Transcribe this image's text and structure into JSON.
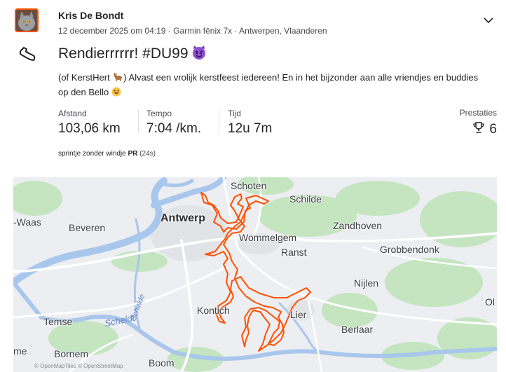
{
  "athlete": {
    "name": "Kris De Bondt"
  },
  "activity": {
    "meta": "12 december 2025 om 04:19 · Garmin fēnix 7x · Antwerpen, Vlaanderen",
    "title": "Rendierrrrrr! #DU99",
    "description_part1": "(of KerstHert ",
    "description_part2": ") Alvast een vrolijk kerstfeest iedereen! En in het bijzonder aan alle vriendjes en buddies op den Bello "
  },
  "stats": [
    {
      "label": "Afstand",
      "value": "103,06 km"
    },
    {
      "label": "Tempo",
      "value": "7:04 /km."
    },
    {
      "label": "Tijd",
      "value": "12u 7m"
    }
  ],
  "achievements": {
    "label": "Prestaties",
    "count": "6"
  },
  "segment_pr": {
    "name": "sprintje zonder windje",
    "badge": "PR",
    "time": "(24s)"
  },
  "map": {
    "places": {
      "schoten": "Schoten",
      "schilde": "Schilde",
      "waas": "-Waas",
      "beveren": "Beveren",
      "antwerp": "Antwerp",
      "zandhoven": "Zandhoven",
      "wommelgem": "Wommelgem",
      "ranst": "Ranst",
      "grobbendonk": "Grobbendonk",
      "nijlen": "Nijlen",
      "kontich": "Kontich",
      "lier": "Lier",
      "ol": "Ol",
      "temse": "Temse",
      "berlaar": "Berlaar",
      "bornem": "Bornem",
      "boom": "Boom",
      "me": "me"
    },
    "rivers": {
      "scheldt": "Scheldt",
      "schelde": "Schelde"
    },
    "copyright": "© OpenMapTiles © OpenStreetMap",
    "route_color": "#fc5200",
    "water_color": "#a9c7ec",
    "park_color": "#c4e5c0"
  },
  "icons": {
    "chevron": "chevron-down-icon",
    "shoe": "running-shoe-icon",
    "trophy": "trophy-icon",
    "devil": "smiling-devil-emoji",
    "deer": "deer-emoji",
    "grin": "grinning-emoji"
  }
}
